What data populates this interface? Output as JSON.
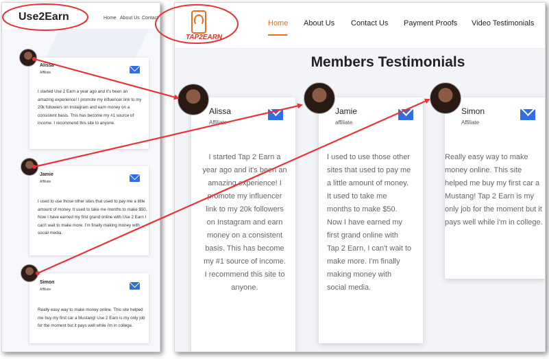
{
  "left": {
    "logo": "Use2Earn",
    "nav": [
      "Home",
      "About Us",
      "Contact"
    ],
    "cards": [
      {
        "name": "Alissa",
        "role": "Affiliate",
        "text": "I started Use 2 Earn a year ago and it's been an amazing experience! I promote my influencer link to my 20k followers on Instagram and earn money on a consistent basis. This has become my #1 source of income. I recommend this site to anyone."
      },
      {
        "name": "Jamie",
        "role": "Affiliate",
        "text": "I used to use those other sites that used to pay me a little amount of money. It used to take me months to make $50. Now I have earned my first grand online with Use 2 Earn I can't wait to make more. I'm finally making money with social media."
      },
      {
        "name": "Simon",
        "role": "Affiliate",
        "text": "Really easy way to make money online. This site helped me buy my first car a Mustang! Use 2 Earn is my only job for the moment but it pays well while i'm in college."
      }
    ]
  },
  "right": {
    "logo_text": "TAP2EARN",
    "nav": [
      "Home",
      "About Us",
      "Contact Us",
      "Payment Proofs",
      "Video Testimonials"
    ],
    "title": "Members Testimonials",
    "cards": [
      {
        "name": "Alissa",
        "role": "Affiliate",
        "text": "I started Tap 2 Earn a year ago and it's been an amazing experience! I promote my influencer link to my 20k followers on Instagram and earn money on a consistent basis. This has become my #1 source of income. I recommend this site to anyone."
      },
      {
        "name": "Jamie",
        "role": "affiliate",
        "text": "I used to use those other sites that used to pay me a little amount of money. It used to take me months to make $50. Now I have earned my first grand online with Tap 2 Earn, I can't wait to make more. I'm finally making money with social media."
      },
      {
        "name": "Simon",
        "role": "Affiliate",
        "text": "Really easy way to make money online. This site helped me buy my first car a Mustang! Tap 2 Earn is my only job for the moment but it pays well while i'm in college."
      }
    ]
  },
  "colors": {
    "accent": "#f06a1e",
    "mail_icon": "#2f6fe0",
    "annotation": "#e8323a"
  },
  "icons": [
    "mail-icon",
    "fingerprint-phone-logo"
  ]
}
